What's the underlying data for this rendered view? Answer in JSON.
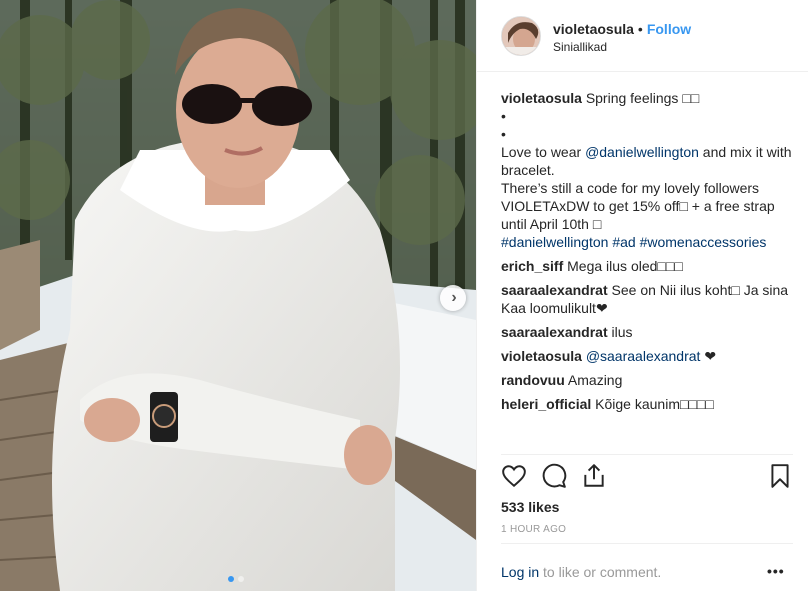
{
  "post": {
    "username": "violetaosula",
    "follow_label": "Follow",
    "bullet": "•",
    "location": "Siniallikad",
    "caption": {
      "username": "violetaosula",
      "line1": "Spring feelings □□",
      "line2": "•",
      "line3": "•",
      "line4_prefix": "Love to wear ",
      "line4_mention": "@danielwellington",
      "line4_suffix": " and mix it with bracelet.",
      "line5": "There’s still a code for my lovely followers VIOLETAxDW to get 15% off□ + a free strap until April 10th □",
      "hashtag1": "#danielwellington",
      "hashtag2": "#ad",
      "hashtag3": "#womenaccessories"
    },
    "comments": [
      {
        "user": "erich_siff",
        "text": "Mega ilus oled□□□"
      },
      {
        "user": "saaraalexandrat",
        "text": "See on Nii ilus koht□ Ja sina Kaa loomulikult❤"
      },
      {
        "user": "saaraalexandrat",
        "text": "ilus"
      },
      {
        "user": "violetaosula",
        "mention": "@saaraalexandrat",
        "text": " ❤"
      },
      {
        "user": "randovuu",
        "text": "Amazing"
      },
      {
        "user": "heleri_official",
        "text": "Kõige kaunim□□□□"
      }
    ],
    "likes": "533 likes",
    "time": "1 HOUR AGO",
    "footer": {
      "login": "Log in",
      "rest": " to like or comment.",
      "more": "•••"
    },
    "next_arrow": "›"
  },
  "icons": {
    "like": "heart-icon",
    "comment": "comment-icon",
    "share": "share-icon",
    "save": "bookmark-icon",
    "next": "chevron-right-icon"
  },
  "colors": {
    "link_blue": "#3897f0",
    "dark_link": "#003569",
    "muted": "#999999"
  }
}
